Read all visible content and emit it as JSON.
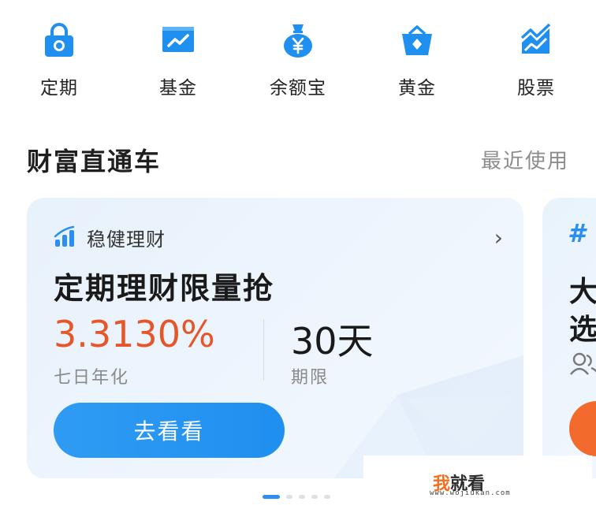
{
  "quick_nav": [
    {
      "label": "定期",
      "icon": "lock-icon"
    },
    {
      "label": "基金",
      "icon": "chart-board-icon"
    },
    {
      "label": "余额宝",
      "icon": "money-bag-icon"
    },
    {
      "label": "黄金",
      "icon": "gold-basket-icon"
    },
    {
      "label": "股票",
      "icon": "stock-trend-icon"
    }
  ],
  "section": {
    "title": "财富直通车",
    "recent": "最近使用"
  },
  "card": {
    "tag_icon": "bar-trend-icon",
    "tag": "稳健理财",
    "chevron": "›",
    "title": "定期理财限量抢",
    "rate_value": "3.3130%",
    "rate_label": "七日年化",
    "term_value": "30天",
    "term_label": "期限",
    "cta": "去看看"
  },
  "card2": {
    "hash": "#",
    "title_line1": "大",
    "title_line2": "选"
  },
  "watermark": {
    "wo": "我",
    "rest": "就看",
    "url": "www.wojiukan.com"
  },
  "pagination": {
    "count": 5,
    "active": 0
  },
  "colors": {
    "brand_blue": "#1f8ff0",
    "rate_orange": "#e5572b",
    "cta_blue": "#2f9bf3",
    "orange_button": "#f26a2c"
  }
}
